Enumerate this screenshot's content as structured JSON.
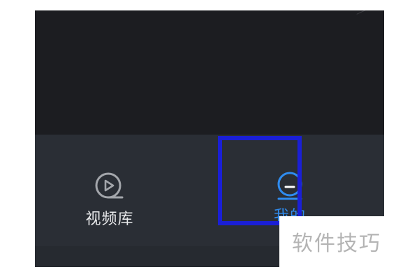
{
  "tabs": [
    {
      "label": "视频库",
      "icon": "play-circle-icon",
      "active": false
    },
    {
      "label": "我的",
      "icon": "profile-circle-icon",
      "active": true
    }
  ],
  "highlight": {
    "color": "#1a1fd6",
    "target": "我的"
  },
  "colors": {
    "background": "#1c1d21",
    "tab_bar": "#2a2e35",
    "active": "#2f8cf0",
    "inactive": "#e8e9eb"
  },
  "watermark": {
    "text": "软件技巧"
  }
}
